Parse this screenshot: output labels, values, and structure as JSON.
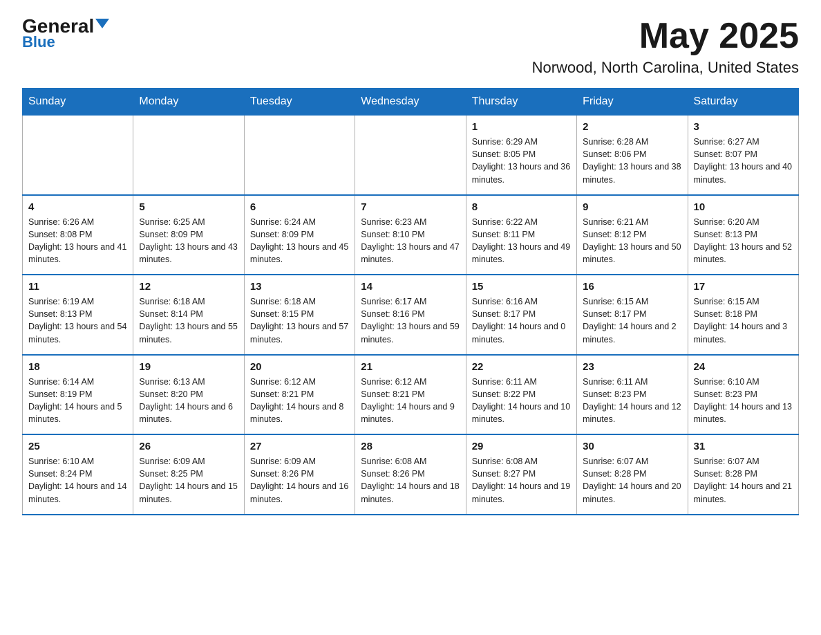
{
  "logo": {
    "general": "General",
    "blue": "Blue"
  },
  "header": {
    "title": "May 2025",
    "subtitle": "Norwood, North Carolina, United States"
  },
  "days_of_week": [
    "Sunday",
    "Monday",
    "Tuesday",
    "Wednesday",
    "Thursday",
    "Friday",
    "Saturday"
  ],
  "weeks": [
    [
      {
        "day": "",
        "info": ""
      },
      {
        "day": "",
        "info": ""
      },
      {
        "day": "",
        "info": ""
      },
      {
        "day": "",
        "info": ""
      },
      {
        "day": "1",
        "info": "Sunrise: 6:29 AM\nSunset: 8:05 PM\nDaylight: 13 hours and 36 minutes."
      },
      {
        "day": "2",
        "info": "Sunrise: 6:28 AM\nSunset: 8:06 PM\nDaylight: 13 hours and 38 minutes."
      },
      {
        "day": "3",
        "info": "Sunrise: 6:27 AM\nSunset: 8:07 PM\nDaylight: 13 hours and 40 minutes."
      }
    ],
    [
      {
        "day": "4",
        "info": "Sunrise: 6:26 AM\nSunset: 8:08 PM\nDaylight: 13 hours and 41 minutes."
      },
      {
        "day": "5",
        "info": "Sunrise: 6:25 AM\nSunset: 8:09 PM\nDaylight: 13 hours and 43 minutes."
      },
      {
        "day": "6",
        "info": "Sunrise: 6:24 AM\nSunset: 8:09 PM\nDaylight: 13 hours and 45 minutes."
      },
      {
        "day": "7",
        "info": "Sunrise: 6:23 AM\nSunset: 8:10 PM\nDaylight: 13 hours and 47 minutes."
      },
      {
        "day": "8",
        "info": "Sunrise: 6:22 AM\nSunset: 8:11 PM\nDaylight: 13 hours and 49 minutes."
      },
      {
        "day": "9",
        "info": "Sunrise: 6:21 AM\nSunset: 8:12 PM\nDaylight: 13 hours and 50 minutes."
      },
      {
        "day": "10",
        "info": "Sunrise: 6:20 AM\nSunset: 8:13 PM\nDaylight: 13 hours and 52 minutes."
      }
    ],
    [
      {
        "day": "11",
        "info": "Sunrise: 6:19 AM\nSunset: 8:13 PM\nDaylight: 13 hours and 54 minutes."
      },
      {
        "day": "12",
        "info": "Sunrise: 6:18 AM\nSunset: 8:14 PM\nDaylight: 13 hours and 55 minutes."
      },
      {
        "day": "13",
        "info": "Sunrise: 6:18 AM\nSunset: 8:15 PM\nDaylight: 13 hours and 57 minutes."
      },
      {
        "day": "14",
        "info": "Sunrise: 6:17 AM\nSunset: 8:16 PM\nDaylight: 13 hours and 59 minutes."
      },
      {
        "day": "15",
        "info": "Sunrise: 6:16 AM\nSunset: 8:17 PM\nDaylight: 14 hours and 0 minutes."
      },
      {
        "day": "16",
        "info": "Sunrise: 6:15 AM\nSunset: 8:17 PM\nDaylight: 14 hours and 2 minutes."
      },
      {
        "day": "17",
        "info": "Sunrise: 6:15 AM\nSunset: 8:18 PM\nDaylight: 14 hours and 3 minutes."
      }
    ],
    [
      {
        "day": "18",
        "info": "Sunrise: 6:14 AM\nSunset: 8:19 PM\nDaylight: 14 hours and 5 minutes."
      },
      {
        "day": "19",
        "info": "Sunrise: 6:13 AM\nSunset: 8:20 PM\nDaylight: 14 hours and 6 minutes."
      },
      {
        "day": "20",
        "info": "Sunrise: 6:12 AM\nSunset: 8:21 PM\nDaylight: 14 hours and 8 minutes."
      },
      {
        "day": "21",
        "info": "Sunrise: 6:12 AM\nSunset: 8:21 PM\nDaylight: 14 hours and 9 minutes."
      },
      {
        "day": "22",
        "info": "Sunrise: 6:11 AM\nSunset: 8:22 PM\nDaylight: 14 hours and 10 minutes."
      },
      {
        "day": "23",
        "info": "Sunrise: 6:11 AM\nSunset: 8:23 PM\nDaylight: 14 hours and 12 minutes."
      },
      {
        "day": "24",
        "info": "Sunrise: 6:10 AM\nSunset: 8:23 PM\nDaylight: 14 hours and 13 minutes."
      }
    ],
    [
      {
        "day": "25",
        "info": "Sunrise: 6:10 AM\nSunset: 8:24 PM\nDaylight: 14 hours and 14 minutes."
      },
      {
        "day": "26",
        "info": "Sunrise: 6:09 AM\nSunset: 8:25 PM\nDaylight: 14 hours and 15 minutes."
      },
      {
        "day": "27",
        "info": "Sunrise: 6:09 AM\nSunset: 8:26 PM\nDaylight: 14 hours and 16 minutes."
      },
      {
        "day": "28",
        "info": "Sunrise: 6:08 AM\nSunset: 8:26 PM\nDaylight: 14 hours and 18 minutes."
      },
      {
        "day": "29",
        "info": "Sunrise: 6:08 AM\nSunset: 8:27 PM\nDaylight: 14 hours and 19 minutes."
      },
      {
        "day": "30",
        "info": "Sunrise: 6:07 AM\nSunset: 8:28 PM\nDaylight: 14 hours and 20 minutes."
      },
      {
        "day": "31",
        "info": "Sunrise: 6:07 AM\nSunset: 8:28 PM\nDaylight: 14 hours and 21 minutes."
      }
    ]
  ]
}
